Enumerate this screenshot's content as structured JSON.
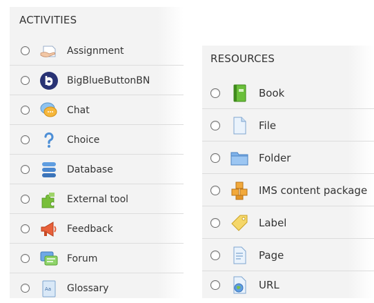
{
  "activities": {
    "header": "ACTIVITIES",
    "items": [
      {
        "label": "Assignment",
        "icon": "assignment-icon"
      },
      {
        "label": "BigBlueButtonBN",
        "icon": "bigbluebutton-icon"
      },
      {
        "label": "Chat",
        "icon": "chat-icon"
      },
      {
        "label": "Choice",
        "icon": "choice-icon"
      },
      {
        "label": "Database",
        "icon": "database-icon"
      },
      {
        "label": "External tool",
        "icon": "external-tool-icon"
      },
      {
        "label": "Feedback",
        "icon": "feedback-icon"
      },
      {
        "label": "Forum",
        "icon": "forum-icon"
      },
      {
        "label": "Glossary",
        "icon": "glossary-icon"
      }
    ]
  },
  "resources": {
    "header": "RESOURCES",
    "items": [
      {
        "label": "Book",
        "icon": "book-icon"
      },
      {
        "label": "File",
        "icon": "file-icon"
      },
      {
        "label": "Folder",
        "icon": "folder-icon"
      },
      {
        "label": "IMS content package",
        "icon": "ims-package-icon"
      },
      {
        "label": "Label",
        "icon": "label-icon"
      },
      {
        "label": "Page",
        "icon": "page-icon"
      },
      {
        "label": "URL",
        "icon": "url-icon"
      }
    ]
  },
  "colors": {
    "panel_bg": "#f3f3f3",
    "divider": "#dcdcdc",
    "text": "#333333"
  }
}
